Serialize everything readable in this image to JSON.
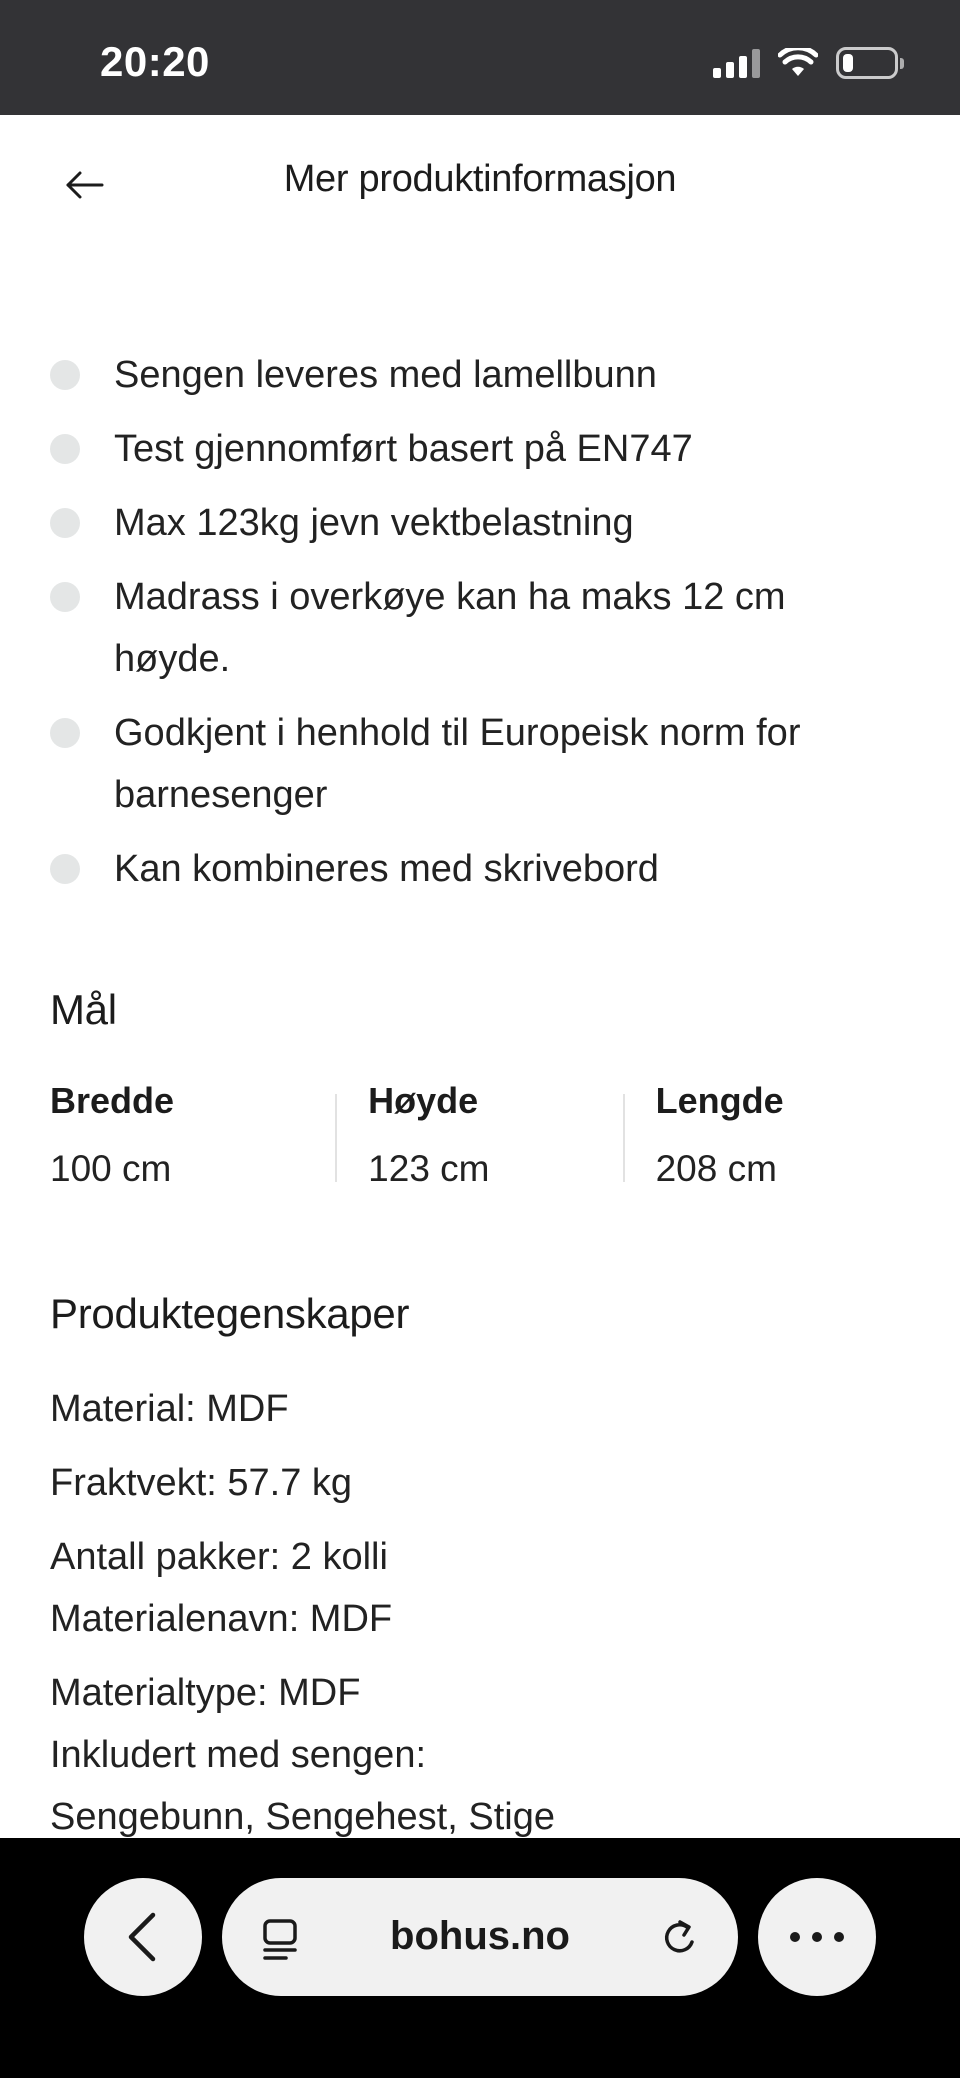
{
  "status_bar": {
    "time": "20:20",
    "signal_icon": "cellular-signal-icon",
    "wifi_icon": "wifi-icon",
    "battery_icon": "battery-icon",
    "battery_level": 0.2
  },
  "header": {
    "title": "Mer produktinformasjon",
    "back_icon": "arrow-left-icon"
  },
  "features": [
    "Sengen leveres med lamellbunn",
    "Test gjennomført basert på EN747",
    "Max 123kg jevn vektbelastning",
    "Madrass i overkøye kan ha maks 12 cm høyde.",
    "Godkjent i henhold til Europeisk norm for barnesenger",
    "Kan kombineres med skrivebord"
  ],
  "dimensions": {
    "title": "Mål",
    "items": [
      {
        "label": "Bredde",
        "value": "100 cm"
      },
      {
        "label": "Høyde",
        "value": "123 cm"
      },
      {
        "label": "Lengde",
        "value": "208 cm"
      }
    ]
  },
  "properties": {
    "title": "Produktegenskaper",
    "lines": [
      "Material: MDF",
      "Fraktvekt: 57.7 kg",
      "Antall pakker: 2 kolli",
      "Materialenavn: MDF",
      "Materialtype: MDF",
      "Inkludert med sengen:",
      "Sengebunn, Sengehest, Stige"
    ]
  },
  "browser_bar": {
    "url": "bohus.no",
    "back_icon": "chevron-left-icon",
    "tabs_icon": "page-tabs-icon",
    "reload_icon": "reload-icon",
    "more_icon": "more-dots-icon"
  },
  "colors": {
    "status_bar_bg": "#333336",
    "browser_bar_bg": "#000000",
    "pill_bg": "#f1f1f1",
    "bullet_dot": "#e4e6e6"
  }
}
